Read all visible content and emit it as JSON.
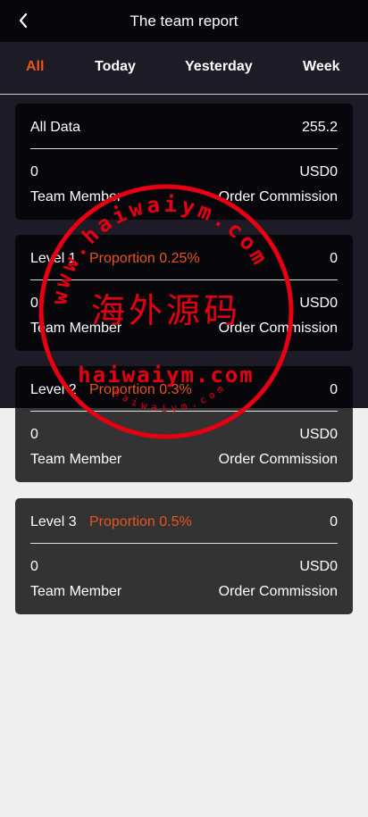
{
  "header": {
    "title": "The team report",
    "back_icon": "chevron-left-icon"
  },
  "tabs": [
    {
      "label": "All",
      "active": true
    },
    {
      "label": "Today",
      "active": false
    },
    {
      "label": "Yesterday",
      "active": false
    },
    {
      "label": "Week",
      "active": false
    }
  ],
  "summary": {
    "label": "All Data",
    "value": "255.2",
    "team_count": "0",
    "commission": "USD0",
    "team_label": "Team Member",
    "commission_label": "Order Commission"
  },
  "levels": [
    {
      "label": "Level 1",
      "proportion": "Proportion 0.25%",
      "value": "0",
      "team_count": "0",
      "commission": "USD0",
      "team_label": "Team Member",
      "commission_label": "Order Commission"
    },
    {
      "label": "Level 2",
      "proportion": "Proportion 0.3%",
      "value": "0",
      "team_count": "0",
      "commission": "USD0",
      "team_label": "Team Member",
      "commission_label": "Order Commission"
    },
    {
      "label": "Level 3",
      "proportion": "Proportion 0.5%",
      "value": "0",
      "team_count": "0",
      "commission": "USD0",
      "team_label": "Team Member",
      "commission_label": "Order Commission"
    }
  ],
  "watermark": {
    "ring_text": "www.haiwaiym.com",
    "main_text": "海外源码",
    "url_text": "haiwaiym.com",
    "small_ring_text": "haiwaiym.com",
    "color": "#e60012"
  },
  "colors": {
    "accent": "#e8541c",
    "header_bg": "#07070b",
    "dark_bg": "#1d1c26",
    "card_dark": "#07070b",
    "card_gray": "#333333",
    "page_bg": "#efefef"
  }
}
